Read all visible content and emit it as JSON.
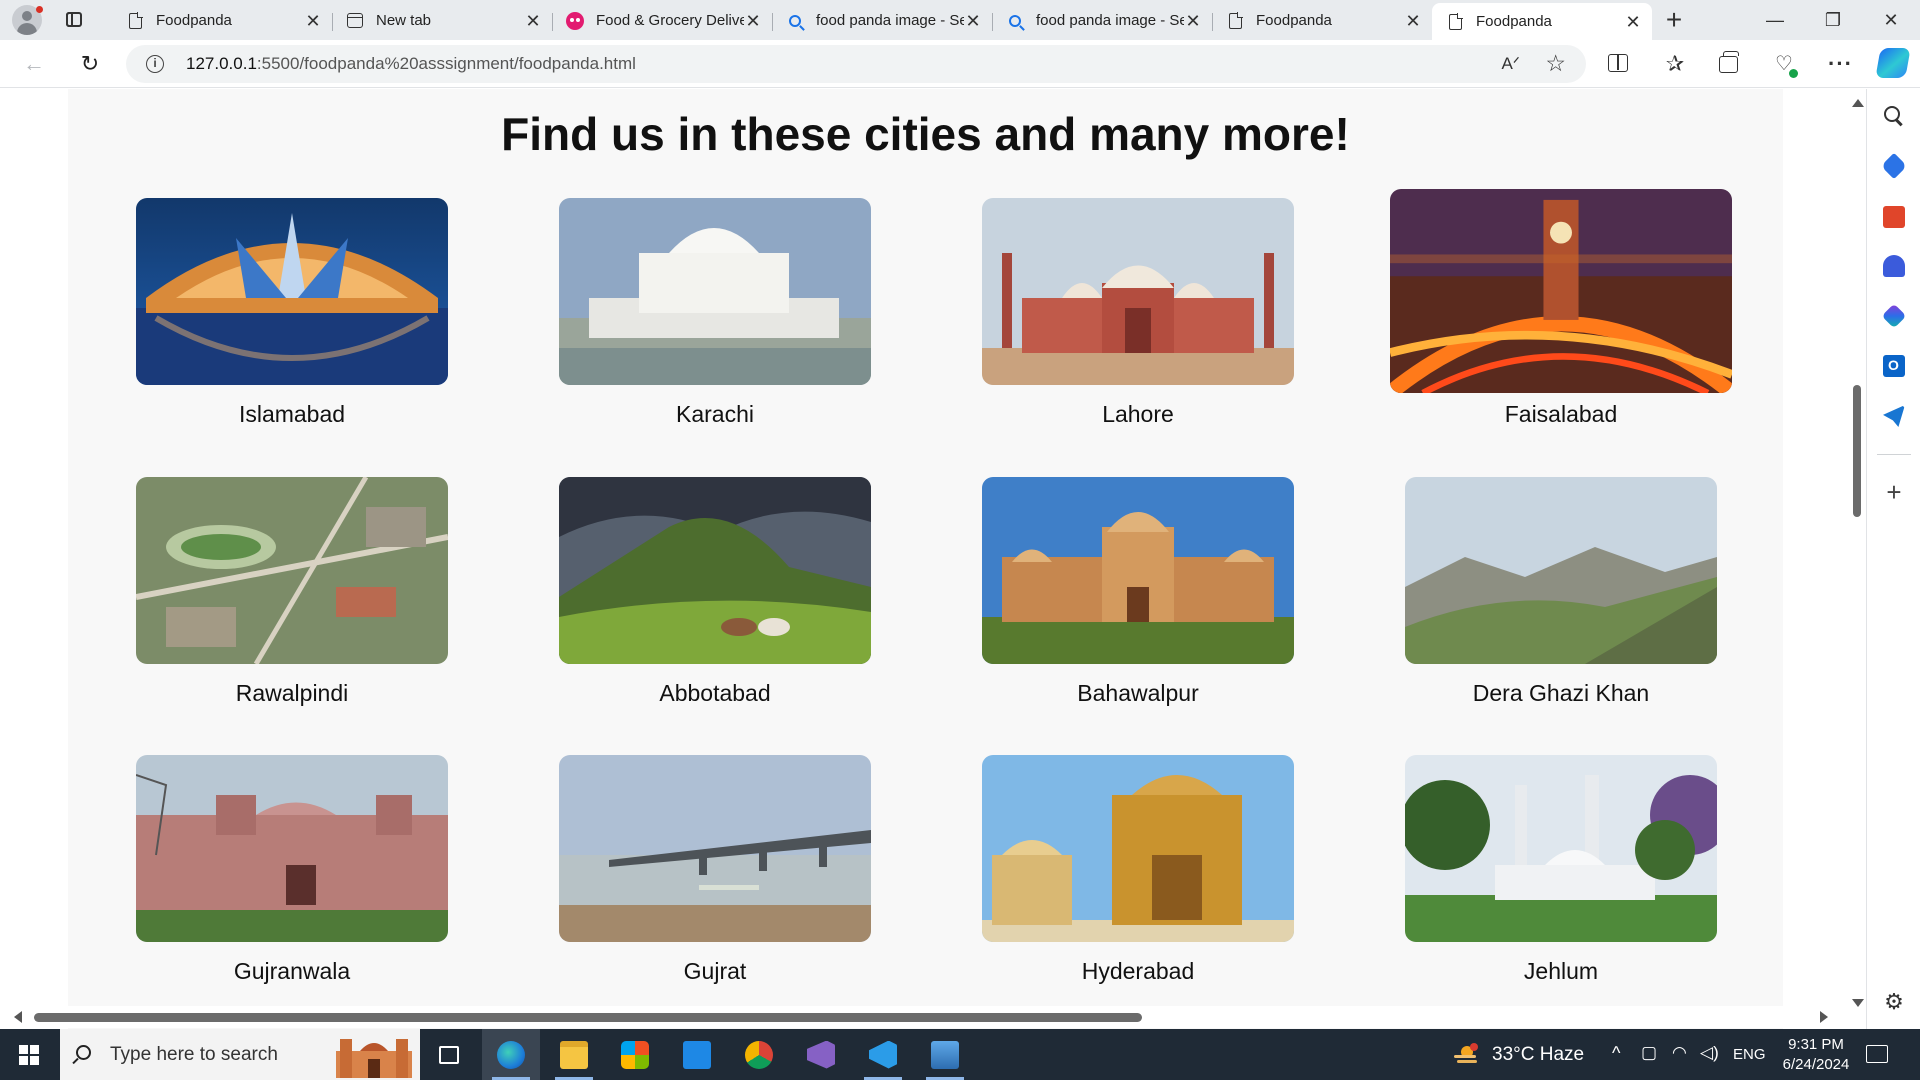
{
  "browser": {
    "tabs": [
      {
        "title": "Foodpanda",
        "icon": "document-icon",
        "active": false
      },
      {
        "title": "New tab",
        "icon": "newtab-icon",
        "active": false
      },
      {
        "title": "Food & Grocery Delivery",
        "icon": "foodpanda-icon",
        "active": false
      },
      {
        "title": "food panda image - Search",
        "icon": "search-icon",
        "active": false
      },
      {
        "title": "food panda image - Search",
        "icon": "search-icon",
        "active": false
      },
      {
        "title": "Foodpanda",
        "icon": "document-icon",
        "active": false
      },
      {
        "title": "Foodpanda",
        "icon": "document-icon",
        "active": true
      }
    ],
    "close_glyph": "✕",
    "new_tab_glyph": "+",
    "window_controls": {
      "minimize": "—",
      "restore": "❐",
      "close": "✕"
    },
    "address": {
      "host": "127.0.0.1",
      "path": ":5500/foodpanda%20asssignment/foodpanda.html"
    },
    "toolbar_glyphs": {
      "back": "←",
      "reload": "↻",
      "info": "i",
      "read_aloud": "Aᐟ",
      "favorite": "☆",
      "favorites": "✰",
      "health": "♡",
      "more": "···"
    }
  },
  "page": {
    "title": "Find us in these cities and many more!",
    "cities": [
      {
        "name": "Islamabad",
        "scene": "monument"
      },
      {
        "name": "Karachi",
        "scene": "mausoleum"
      },
      {
        "name": "Lahore",
        "scene": "mosque"
      },
      {
        "name": "Faisalabad",
        "scene": "clocktower"
      },
      {
        "name": "Rawalpindi",
        "scene": "aerial"
      },
      {
        "name": "Abbotabad",
        "scene": "hills"
      },
      {
        "name": "Bahawalpur",
        "scene": "palace"
      },
      {
        "name": "Dera Ghazi Khan",
        "scene": "mountains"
      },
      {
        "name": "Gujranwala",
        "scene": "fort"
      },
      {
        "name": "Gujrat",
        "scene": "bridge"
      },
      {
        "name": "Hyderabad",
        "scene": "tomb"
      },
      {
        "name": "Jehlum",
        "scene": "minarets"
      }
    ]
  },
  "sidebar": {
    "items": [
      "search-icon",
      "shopping-icon",
      "tools-icon",
      "games-icon",
      "office-icon",
      "outlook-icon",
      "telegram-icon"
    ],
    "add_glyph": "+",
    "settings_glyph": "⚙"
  },
  "taskbar": {
    "search_placeholder": "Type here to search",
    "apps": [
      "task-view-icon",
      "edge-icon",
      "file-explorer-icon",
      "store-icon",
      "mail-icon",
      "chrome-icon",
      "visual-studio-icon",
      "vscode-icon",
      "photos-icon"
    ],
    "weather": "33°C  Haze",
    "chevron": "^",
    "lang": "ENG",
    "time": "9:31 PM",
    "date": "6/24/2024"
  }
}
